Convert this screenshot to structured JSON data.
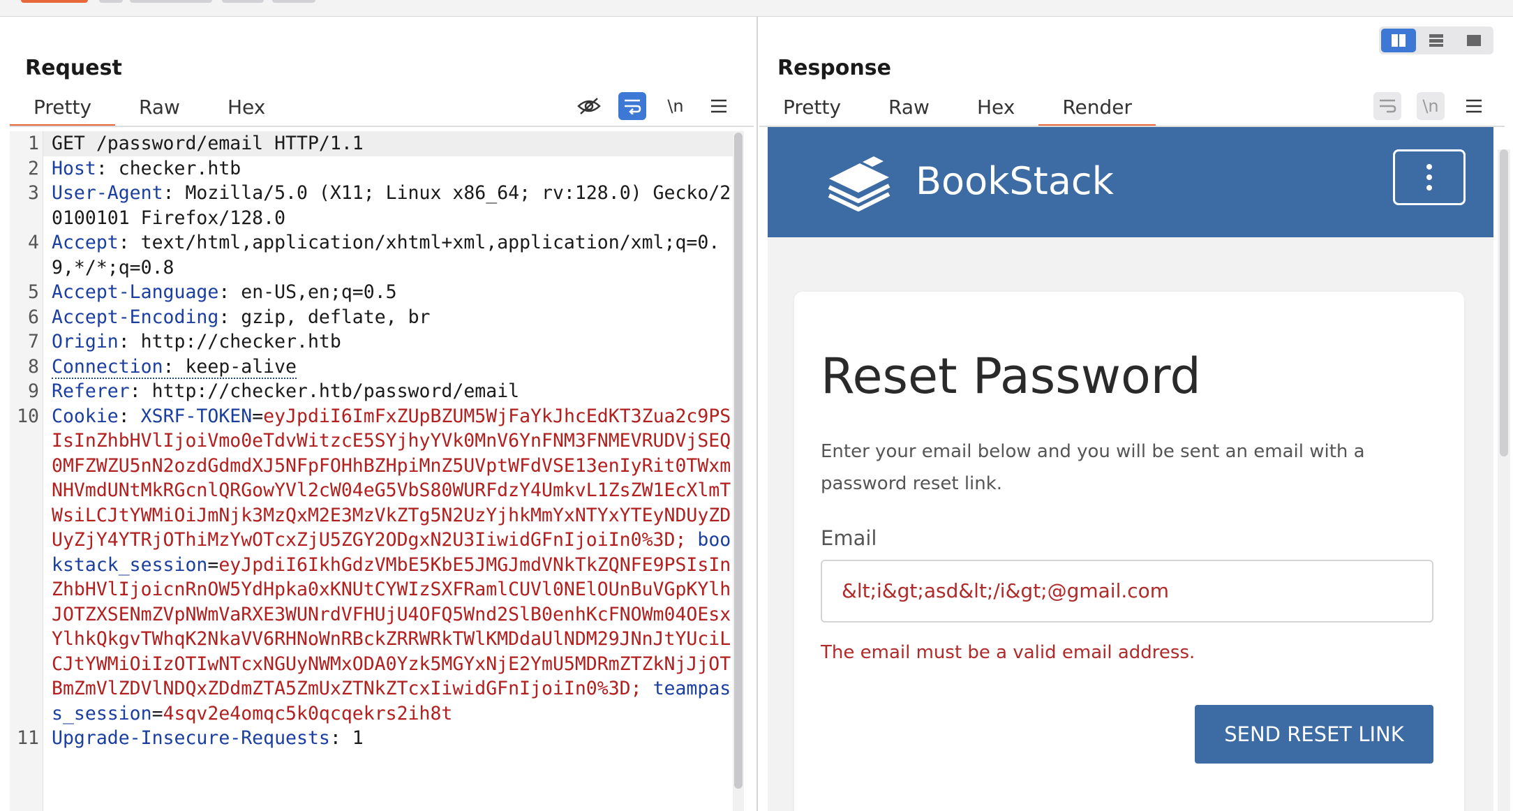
{
  "request": {
    "title": "Request",
    "tabs": [
      "Pretty",
      "Raw",
      "Hex"
    ],
    "active_tab": "Pretty",
    "tools": {
      "hide": "eye-slash-icon",
      "wrap": "wrap-icon",
      "newline": "\\n",
      "menu": "menu-icon"
    },
    "lines": [
      {
        "n": "1",
        "raw": "GET /password/email HTTP/1.1"
      },
      {
        "n": "2",
        "key": "Host",
        "value": " checker.htb"
      },
      {
        "n": "3",
        "key": "User-Agent",
        "value": " Mozilla/5.0 (X11; Linux x86_64; rv:128.0) Gecko/20100101 Firefox/128.0"
      },
      {
        "n": "4",
        "key": "Accept",
        "value": " text/html,application/xhtml+xml,application/xml;q=0.9,*/*;q=0.8"
      },
      {
        "n": "5",
        "key": "Accept-Language",
        "value": " en-US,en;q=0.5"
      },
      {
        "n": "6",
        "key": "Accept-Encoding",
        "value": " gzip, deflate, br"
      },
      {
        "n": "7",
        "key": "Origin",
        "value": " http://checker.htb"
      },
      {
        "n": "8",
        "key": "Connection",
        "value": " keep-alive"
      },
      {
        "n": "9",
        "key": "Referer",
        "value": " http://checker.htb/password/email"
      },
      {
        "n": "10",
        "key": "Cookie",
        "cookies": [
          {
            "name": "XSRF-TOKEN",
            "value": "eyJpdiI6ImFxZUpBZUM5WjFaYkJhcEdKT3Zua2c9PSIsInZhbHVlIjoiVmo0eTdvWitzcE5SYjhyYVk0MnV6YnFNM3FNMEVRUDVjSEQ0MFZWZU5nN2ozdGdmdXJ5NFpFOHhBZHpiMnZ5UVptWFdVSE13enIyRit0TWxmNHVmdUNtMkRGcnlQRGowYVl2cW04eG5VbS80WURFdzY4UmkvL1ZsZW1EcXlmTWsiLCJtYWMiOiJmNjk3MzQxM2E3MzVkZTg5N2UzYjhkMmYxNTYxYTEyNDUyZDUyZjY4YTRjOThiMzYwOTcxZjU5ZGY2ODgxN2U3IiwidGFnIjoiIn0%3D;"
          },
          {
            "name": "bookstack_session",
            "value": "eyJpdiI6IkhGdzVMbE5KbE5JMGJmdVNkTkZQNFE9PSIsInZhbHVlIjoicnRnOW5YdHpka0xKNUtCYWIzSXFRamlCUVl0NElOUnBuVGpKYlhJOTZXSENmZVpNWmVaRXE3WUNrdVFHUjU4OFQ5Wnd2SlB0enhKcFNOWm04OEsxYlhkQkgvTWhqK2NkaVV6RHNoWnRBckZRRWRkTWlKMDdaUlNDM29JNnJtYUciLCJtYWMiOiIzOTIwNTcxNGUyNWMxODA0Yzk5MGYxNjE2YmU5MDRmZTZkNjJjOTBmZmVlZDVlNDQxZDdmZTA5ZmUxZTNkZTcxIiwidGFnIjoiIn0%3D;"
          },
          {
            "name": "teampass_session",
            "value": "4sqv2e4omqc5k0qcqekrs2ih8t"
          }
        ]
      },
      {
        "n": "11",
        "key": "Upgrade-Insecure-Requests",
        "value": " 1"
      }
    ]
  },
  "response": {
    "title": "Response",
    "tabs": [
      "Pretty",
      "Raw",
      "Hex",
      "Render"
    ],
    "active_tab": "Render",
    "tools": {
      "wrap": "wrap-icon",
      "newline": "\\n",
      "menu": "menu-icon"
    },
    "layout_buttons": [
      "split-horizontal-icon",
      "split-vertical-icon",
      "single-pane-icon"
    ],
    "render": {
      "brand": "BookStack",
      "heading": "Reset Password",
      "description": "Enter your email below and you will be sent an email with a password reset link.",
      "email_label": "Email",
      "email_value": "&lt;i&gt;asd&lt;/i&gt;@gmail.com",
      "error": "The email must be a valid email address.",
      "button": "SEND RESET LINK",
      "header_color": "#3d6ba3"
    }
  },
  "colors": {
    "accent": "#e8683a",
    "active_tool": "#3d79d4",
    "header_key": "#1b3fa0",
    "cookie_value": "#b21f1f"
  }
}
